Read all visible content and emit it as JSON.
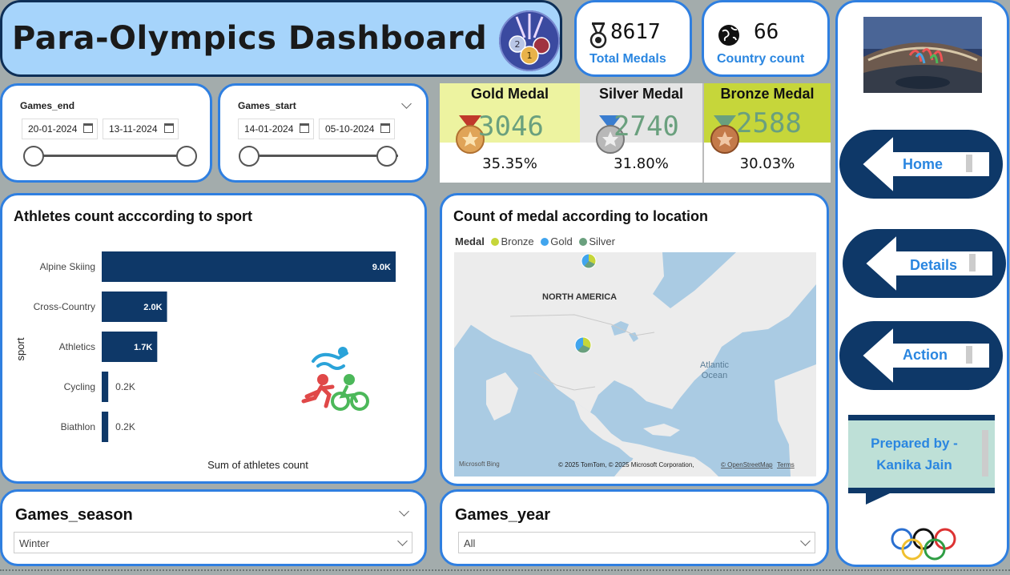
{
  "title": "Para-Olympics Dashboard",
  "kpis": {
    "total_medals": {
      "value": "8617",
      "label": "Total Medals"
    },
    "country_count": {
      "value": "66",
      "label": "Country count"
    }
  },
  "slicers": {
    "games_end": {
      "label": "Games_end",
      "from": "20-01-2024",
      "to": "13-11-2024"
    },
    "games_start": {
      "label": "Games_start",
      "from": "14-01-2024",
      "to": "05-10-2024"
    }
  },
  "medals": {
    "gold": {
      "name": "Gold Medal",
      "value": "3046",
      "pct": "35.35%",
      "color": "#edf3a0"
    },
    "silver": {
      "name": "Silver Medal",
      "value": "2740",
      "pct": "31.80%",
      "color": "#e5e5e5"
    },
    "bronze": {
      "name": "Bronze Medal",
      "value": "2588",
      "pct": "30.03%",
      "color": "#c6d63a"
    }
  },
  "athlete_chart": {
    "title": "Athletes count acccording to sport"
  },
  "chart_data": {
    "type": "bar",
    "orientation": "horizontal",
    "categories": [
      "Alpine Skiing",
      "Cross-Country",
      "Athletics",
      "Cycling",
      "Biathlon"
    ],
    "values": [
      9000,
      2000,
      1700,
      200,
      200
    ],
    "data_labels": [
      "9.0K",
      "2.0K",
      "1.7K",
      "0.2K",
      "0.2K"
    ],
    "xlabel": "Sum of athletes count",
    "ylabel": "sport",
    "xlim": [
      0,
      9000
    ],
    "color": "#0e3868",
    "grid": false
  },
  "map": {
    "title": "Count of medal according to location",
    "legend_title": "Medal",
    "legend": [
      {
        "name": "Bronze",
        "color": "#c6d63a"
      },
      {
        "name": "Gold",
        "color": "#41a5ee"
      },
      {
        "name": "Silver",
        "color": "#6aa07e"
      }
    ],
    "region_label": "NORTH AMERICA",
    "ocean_label_1": "Atlantic",
    "ocean_label_2": "Ocean",
    "brand": "Microsoft Bing",
    "attribution": "© 2025 TomTom, © 2025 Microsoft Corporation,",
    "osm": "© OpenStreetMap",
    "terms": "Terms"
  },
  "season": {
    "label": "Games_season",
    "value": "Winter"
  },
  "year": {
    "label": "Games_year",
    "value": "All"
  },
  "nav": {
    "home": "Home",
    "details": "Details",
    "action": "Action",
    "prepared_line1": "Prepared by   -",
    "prepared_line2": "Kanika Jain"
  }
}
